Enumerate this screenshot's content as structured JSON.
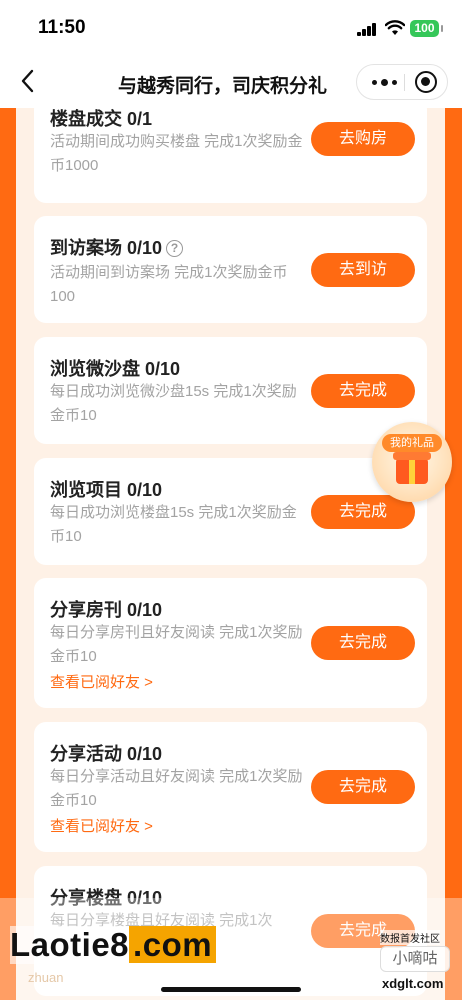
{
  "status_bar": {
    "time": "11:50",
    "battery": "100"
  },
  "nav": {
    "title": "与越秀同行，司庆积分礼",
    "back_icon": "chevron-left-icon",
    "more_icon": "more-dots-icon",
    "close_icon": "mini-program-close-icon"
  },
  "tasks": [
    {
      "title": "楼盘成交 0/1",
      "desc": "活动期间成功购买楼盘 完成1次奖励金币1000",
      "button": "去购房"
    },
    {
      "title": "到访案场 0/10",
      "has_help": true,
      "help_icon": "question-icon",
      "desc": "活动期间到访案场 完成1次奖励金币100",
      "button": "去到访"
    },
    {
      "title": "浏览微沙盘 0/10",
      "desc": "每日成功浏览微沙盘15s 完成1次奖励金币10",
      "button": "去完成"
    },
    {
      "title": "浏览项目 0/10",
      "desc": "每日成功浏览楼盘15s 完成1次奖励金币10",
      "button": "去完成"
    },
    {
      "title": "分享房刊 0/10",
      "desc": "每日分享房刊且好友阅读 完成1次奖励金币10",
      "link": "查看已阅好友 >",
      "button": "去完成"
    },
    {
      "title": "分享活动 0/10",
      "desc": "每日分享活动且好友阅读 完成1次奖励金币10",
      "link": "查看已阅好友 >",
      "button": "去完成"
    },
    {
      "title": "分享楼盘 0/10",
      "desc": "每日分享楼盘且好友阅读 完成1次",
      "button": "去完成"
    }
  ],
  "floating_badge": {
    "label": "我的礼品",
    "icon": "gift-icon"
  },
  "watermark": {
    "brand_prefix": "Laotie8",
    "brand_suffix": ".com",
    "sub": "zhuan",
    "right_top": "数报首发社区",
    "right_mid": "小嘀咕",
    "right_bottom": "xdglt.com"
  },
  "colors": {
    "accent": "#ff6a12",
    "panel": "#fef1e6",
    "card": "#ffffff",
    "text_gray": "#a3a3a3"
  }
}
